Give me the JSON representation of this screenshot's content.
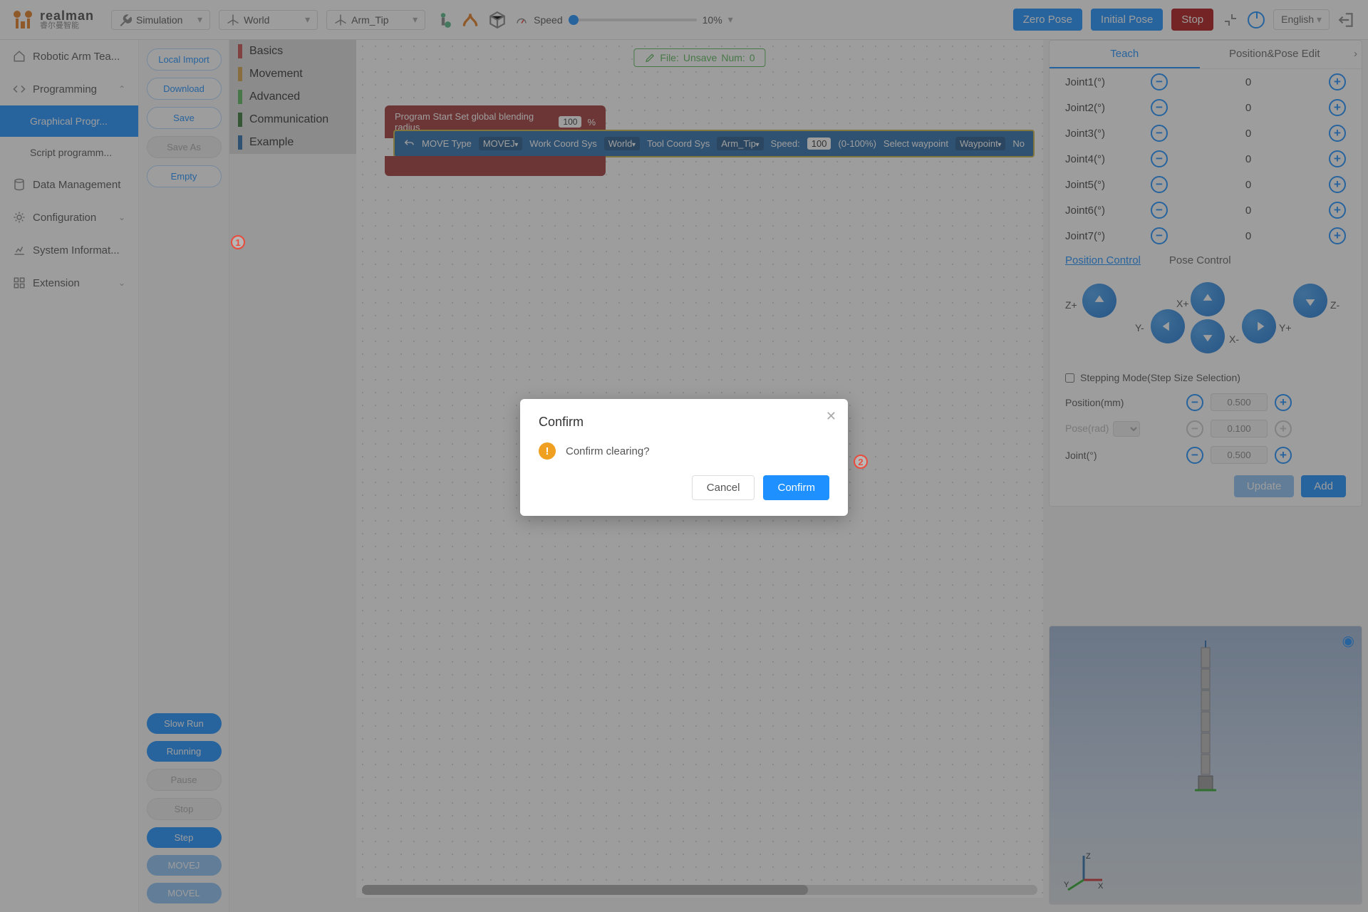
{
  "logo": {
    "name": "realman",
    "sub": "睿尔曼智能"
  },
  "topbar": {
    "mode": "Simulation",
    "worldSys": "World",
    "toolSys": "Arm_Tip",
    "speedLabel": "Speed",
    "speedValue": "10%",
    "zeroPose": "Zero Pose",
    "initialPose": "Initial Pose",
    "stop": "Stop",
    "language": "English"
  },
  "nav": {
    "items": [
      "Robotic Arm Tea...",
      "Programming",
      "Graphical Progr...",
      "Script programm...",
      "Data Management",
      "Configuration",
      "System Informat...",
      "Extension"
    ]
  },
  "btncol": {
    "localImport": "Local Import",
    "download": "Download",
    "save": "Save",
    "saveAs": "Save As",
    "empty": "Empty",
    "slowRun": "Slow Run",
    "running": "Running",
    "pause": "Pause",
    "stop": "Stop",
    "step": "Step",
    "movej": "MOVEJ",
    "movel": "MOVEL"
  },
  "cats": [
    "Basics",
    "Movement",
    "Advanced",
    "Communication",
    "Example"
  ],
  "catColors": [
    "#c94f4f",
    "#d6a64a",
    "#5cb85c",
    "#3a7a3a",
    "#2e6fad"
  ],
  "canvas": {
    "fileLabel": "File:",
    "unsave": "Unsave",
    "numLabel": "Num:",
    "numVal": "0",
    "blockStart": "Program Start  Set global blending radius",
    "blockStartVal": "100",
    "blockStartUnit": "%",
    "move": {
      "typeLbl": "MOVE Type",
      "type": "MOVEJ",
      "workLbl": "Work Coord Sys",
      "work": "World",
      "toolLbl": "Tool Coord Sys",
      "tool": "Arm_Tip",
      "speedLbl": "Speed:",
      "speedVal": "100",
      "speedRange": "(0-100%)",
      "wpLbl": "Select waypoint",
      "wp": "Waypoint",
      "non": "No"
    }
  },
  "right": {
    "tabs": [
      "Teach",
      "Position&Pose Edit"
    ],
    "joints": [
      "Joint1(°)",
      "Joint2(°)",
      "Joint3(°)",
      "Joint4(°)",
      "Joint5(°)",
      "Joint6(°)",
      "Joint7(°)"
    ],
    "jointVals": [
      "0",
      "0",
      "0",
      "0",
      "0",
      "0",
      "0"
    ],
    "subTabs": [
      "Position Control",
      "Pose Control"
    ],
    "axes": {
      "zp": "Z+",
      "zm": "Z-",
      "xp": "X+",
      "xm": "X-",
      "yp": "Y+",
      "ym": "Y-"
    },
    "stepChk": "Stepping Mode(Step Size Selection)",
    "posLabel": "Position(mm)",
    "posVal": "0.500",
    "poseLabel": "Pose(rad)",
    "poseVal": "0.100",
    "jointLabel": "Joint(°)",
    "jointStepVal": "0.500",
    "update": "Update",
    "add": "Add"
  },
  "dialog": {
    "title": "Confirm",
    "msg": "Confirm clearing?",
    "cancel": "Cancel",
    "confirm": "Confirm"
  },
  "annotations": {
    "a1": "1",
    "a2": "2"
  }
}
